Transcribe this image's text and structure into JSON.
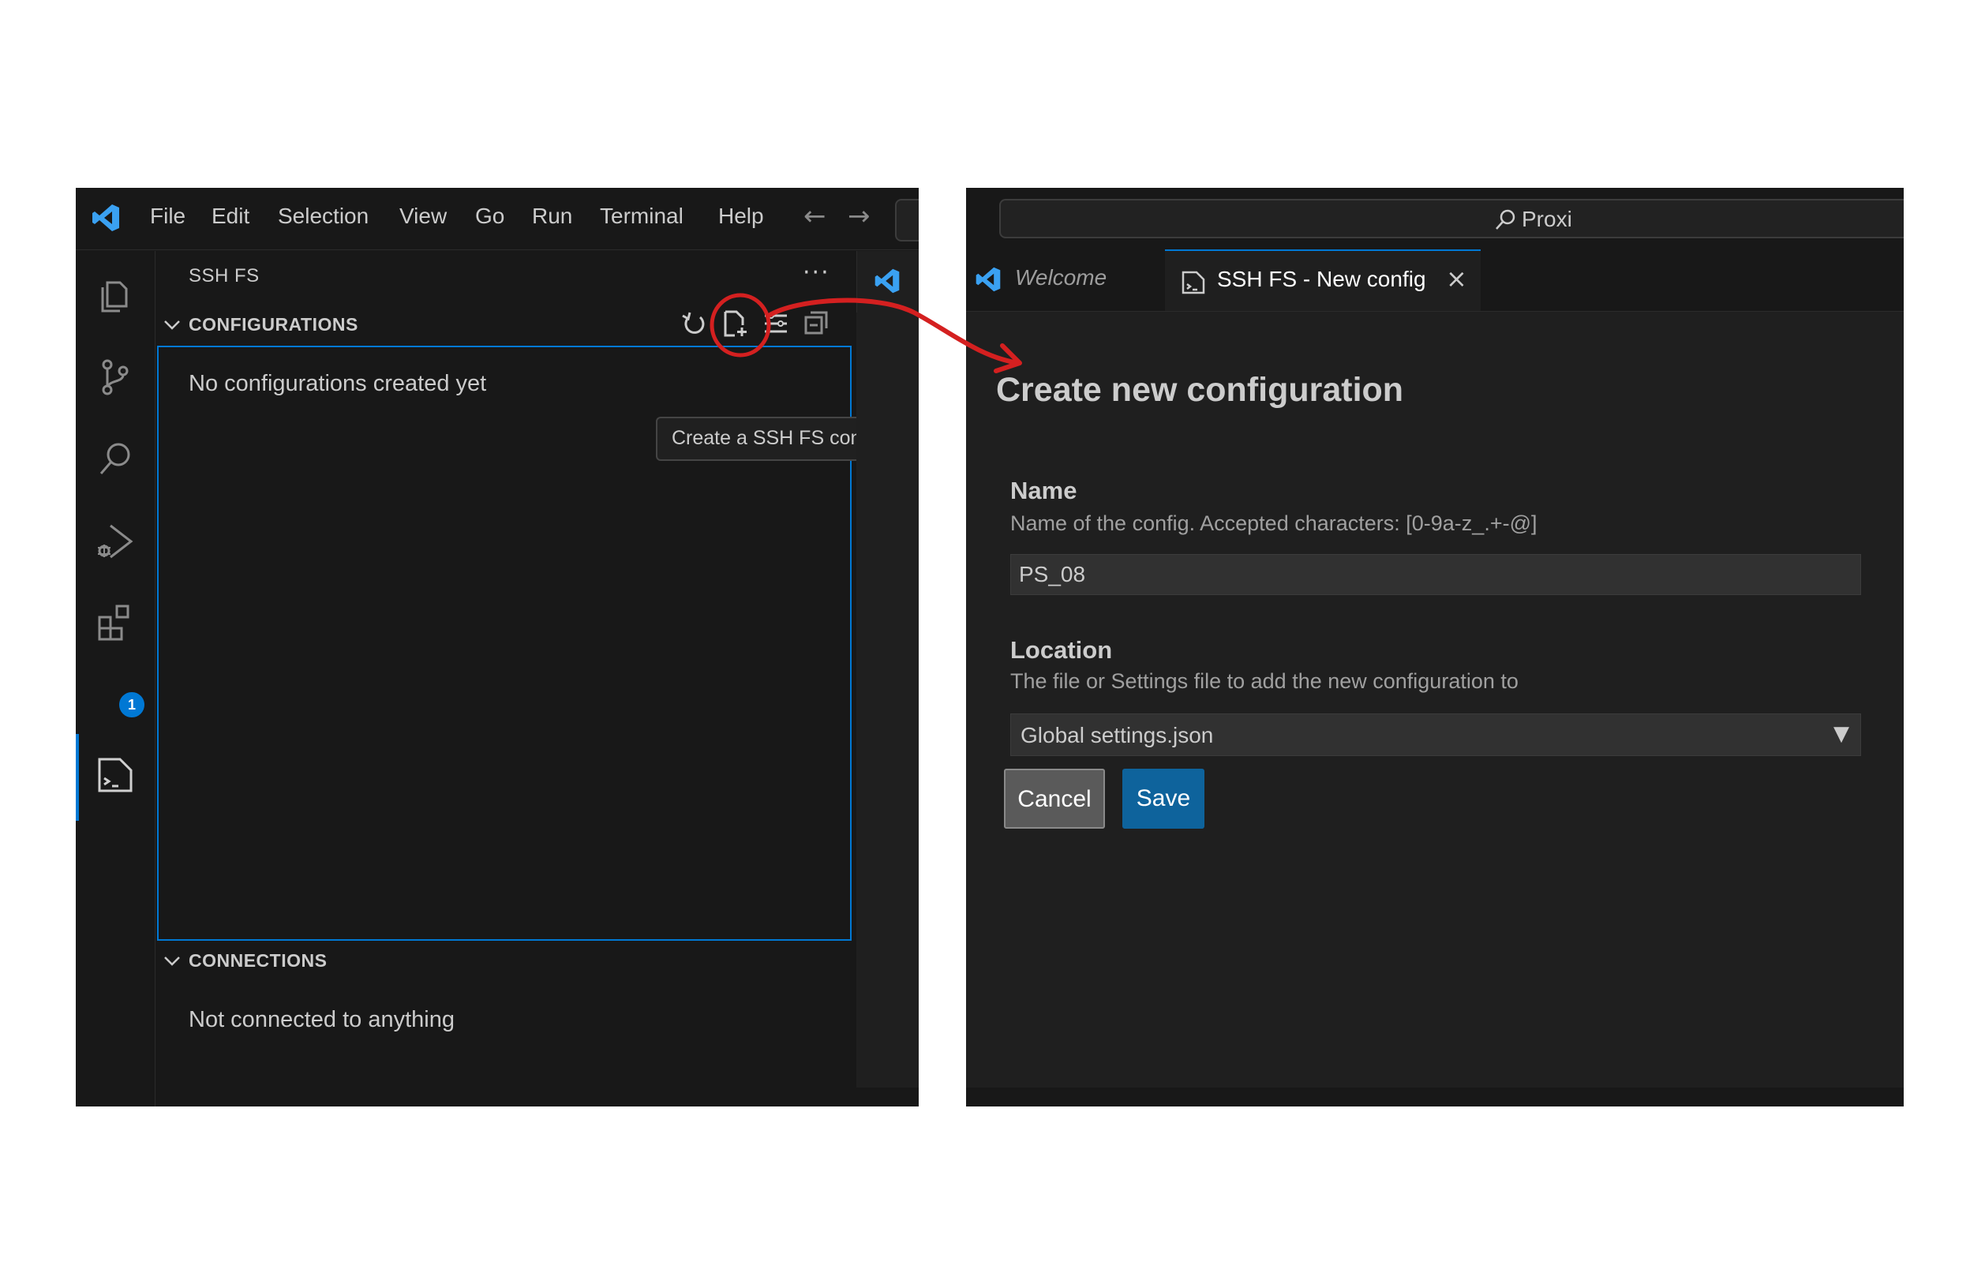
{
  "left_window": {
    "menu": [
      "File",
      "Edit",
      "Selection",
      "View",
      "Go",
      "Run",
      "Terminal",
      "Help"
    ],
    "sidebar": {
      "title": "SSH FS",
      "configurations": {
        "header": "CONFIGURATIONS",
        "empty_message": "No configurations created yet"
      },
      "connections": {
        "header": "CONNECTIONS",
        "empty_message": "Not connected to anything"
      },
      "tooltip": "Create a SSH FS configuration"
    },
    "activity_bar": {
      "icons": [
        "explorer-icon",
        "source-control-icon",
        "search-icon",
        "run-debug-icon",
        "extensions-icon",
        "ssh-fs-icon"
      ],
      "extensions_badge": "1"
    }
  },
  "right_window": {
    "search_text": "Proxi",
    "tabs": [
      {
        "label": "Welcome",
        "active": false
      },
      {
        "label": "SSH FS - New config",
        "active": true
      }
    ],
    "form": {
      "heading": "Create new configuration",
      "name_label": "Name",
      "name_description": "Name of the config. Accepted characters: [0-9a-z_.+-@]",
      "name_value": "PS_08",
      "location_label": "Location",
      "location_description": "The file or Settings file to add the new configuration to",
      "location_value": "Global settings.json",
      "cancel_label": "Cancel",
      "save_label": "Save"
    }
  },
  "colors": {
    "accent": "#0078d4",
    "annotation": "#d42020",
    "save_button": "#0e639c",
    "vscode_logo": "#3aa1f2"
  }
}
